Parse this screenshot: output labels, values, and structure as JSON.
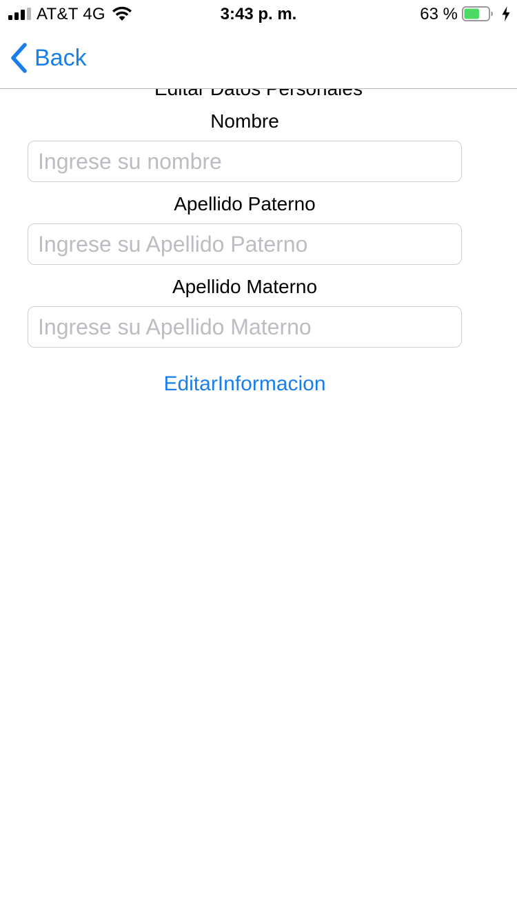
{
  "status_bar": {
    "carrier": "AT&T 4G",
    "time": "3:43 p. m.",
    "battery_percent_label": "63 %",
    "battery_level": 0.63,
    "signal_bars_active": 3,
    "signal_bars_total": 4,
    "charging": true,
    "battery_color": "#4cd964"
  },
  "nav": {
    "back_label": "Back",
    "accent_color": "#1a7ee8"
  },
  "form": {
    "title": "Editar Datos Personales",
    "fields": [
      {
        "label": "Nombre",
        "placeholder": "Ingrese su nombre",
        "value": ""
      },
      {
        "label": "Apellido Paterno",
        "placeholder": "Ingrese su Apellido Paterno",
        "value": ""
      },
      {
        "label": "Apellido Materno",
        "placeholder": "Ingrese su Apellido Materno",
        "value": ""
      }
    ],
    "submit_label": "EditarInformacion"
  },
  "icons": [
    "signal-icon",
    "wifi-icon",
    "battery-icon",
    "charging-bolt-icon",
    "chevron-left-icon"
  ]
}
